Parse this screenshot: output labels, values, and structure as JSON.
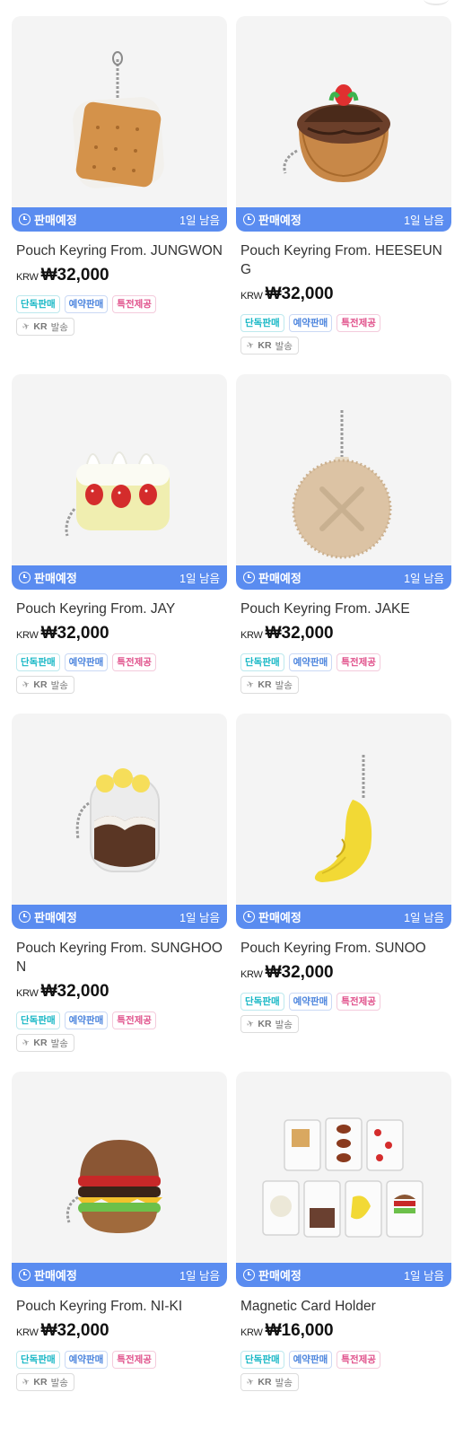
{
  "products": [
    {
      "title": "Pouch Keyring From. JUNGWON",
      "currency": "KRW",
      "price": "₩32,000",
      "status": "판매예정",
      "remaining": "1일 남음",
      "tags": [
        "단독판매",
        "예약판매",
        "특전제공"
      ],
      "ship_region": "KR",
      "ship_label": "발송",
      "image_icon": "cracker-pouch"
    },
    {
      "title": "Pouch Keyring From. HEESEUNG",
      "currency": "KRW",
      "price": "₩32,000",
      "status": "판매예정",
      "remaining": "1일 남음",
      "tags": [
        "단독판매",
        "예약판매",
        "특전제공"
      ],
      "ship_region": "KR",
      "ship_label": "발송",
      "image_icon": "tart-pouch"
    },
    {
      "title": "Pouch Keyring From. JAY",
      "currency": "KRW",
      "price": "₩32,000",
      "status": "판매예정",
      "remaining": "1일 남음",
      "tags": [
        "단독판매",
        "예약판매",
        "특전제공"
      ],
      "ship_region": "KR",
      "ship_label": "발송",
      "image_icon": "strawberry-cake-pouch"
    },
    {
      "title": "Pouch Keyring From. JAKE",
      "currency": "KRW",
      "price": "₩32,000",
      "status": "판매예정",
      "remaining": "1일 남음",
      "tags": [
        "단독판매",
        "예약판매",
        "특전제공"
      ],
      "ship_region": "KR",
      "ship_label": "발송",
      "image_icon": "cookie-pouch"
    },
    {
      "title": "Pouch Keyring From. SUNGHOON",
      "currency": "KRW",
      "price": "₩32,000",
      "status": "판매예정",
      "remaining": "1일 남음",
      "tags": [
        "단독판매",
        "예약판매",
        "특전제공"
      ],
      "ship_region": "KR",
      "ship_label": "발송",
      "image_icon": "dessert-cup-pouch"
    },
    {
      "title": "Pouch Keyring From. SUNOO",
      "currency": "KRW",
      "price": "₩32,000",
      "status": "판매예정",
      "remaining": "1일 남음",
      "tags": [
        "단독판매",
        "예약판매",
        "특전제공"
      ],
      "ship_region": "KR",
      "ship_label": "발송",
      "image_icon": "banana-pouch"
    },
    {
      "title": "Pouch Keyring From. NI-KI",
      "currency": "KRW",
      "price": "₩32,000",
      "status": "판매예정",
      "remaining": "1일 남음",
      "tags": [
        "단독판매",
        "예약판매",
        "특전제공"
      ],
      "ship_region": "KR",
      "ship_label": "발송",
      "image_icon": "burger-pouch"
    },
    {
      "title": "Magnetic Card Holder",
      "currency": "KRW",
      "price": "₩16,000",
      "status": "판매예정",
      "remaining": "1일 남음",
      "tags": [
        "단독판매",
        "예약판매",
        "특전제공"
      ],
      "ship_region": "KR",
      "ship_label": "발송",
      "image_icon": "card-holder-set"
    }
  ],
  "colors": {
    "status_bar": "#5a8cf0",
    "tag_exclusive": "#19b8c6",
    "tag_preorder": "#4e86de",
    "tag_benefit": "#e0508a"
  }
}
